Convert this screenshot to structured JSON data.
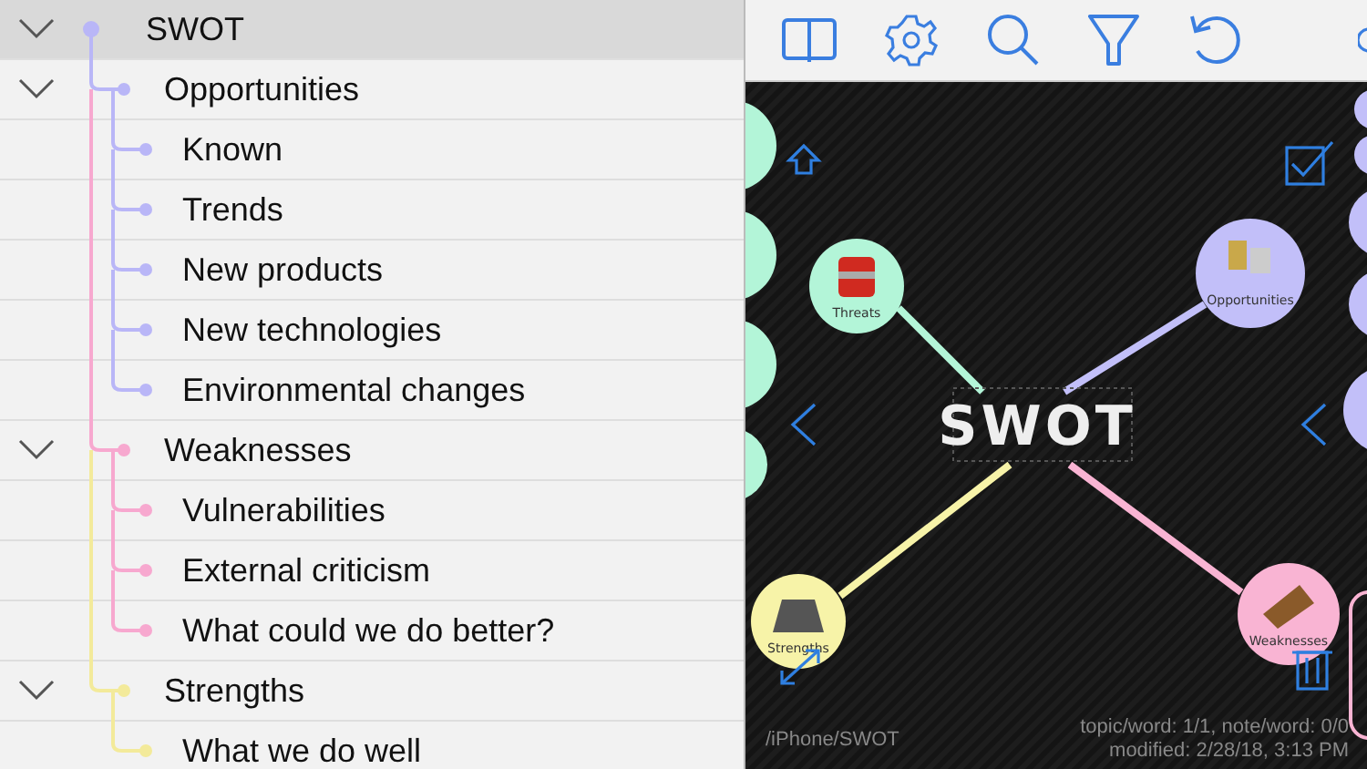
{
  "outline": {
    "label": "SWOT",
    "selected": true,
    "expanded": true,
    "color": "#b9b6f7",
    "children": [
      {
        "label": "Opportunities",
        "selected": false,
        "expanded": true,
        "color": "#b9b6f7",
        "children": [
          {
            "label": "Known",
            "selected": false
          },
          {
            "label": "Trends",
            "selected": false
          },
          {
            "label": "New products",
            "selected": false
          },
          {
            "label": "New technologies",
            "selected": false
          },
          {
            "label": "Environmental changes",
            "selected": false
          }
        ]
      },
      {
        "label": "Weaknesses",
        "selected": false,
        "expanded": true,
        "color": "#f7a8cf",
        "children": [
          {
            "label": "Vulnerabilities",
            "selected": false
          },
          {
            "label": "External criticism",
            "selected": false
          },
          {
            "label": "What could we do better?",
            "selected": false
          }
        ]
      },
      {
        "label": "Strengths",
        "selected": false,
        "expanded": true,
        "color": "#f3ea9a",
        "children": [
          {
            "label": "What we do well",
            "selected": false
          }
        ]
      }
    ]
  },
  "map": {
    "center": "SWOT",
    "nodes": [
      {
        "kind": "threats",
        "label": "Threats",
        "color": "#b3f5d8"
      },
      {
        "kind": "opportunities",
        "label": "Opportunities",
        "color": "#c2bff9"
      },
      {
        "kind": "strengths",
        "label": "Strengths",
        "color": "#f7f3a8"
      },
      {
        "kind": "weaknesses",
        "label": "Weaknesses",
        "color": "#f9b4d3"
      }
    ],
    "path": "/iPhone/SWOT",
    "stats": "topic/word: 1/1, note/word: 0/0",
    "modified": "modified: 2/28/18, 3:13 PM"
  }
}
